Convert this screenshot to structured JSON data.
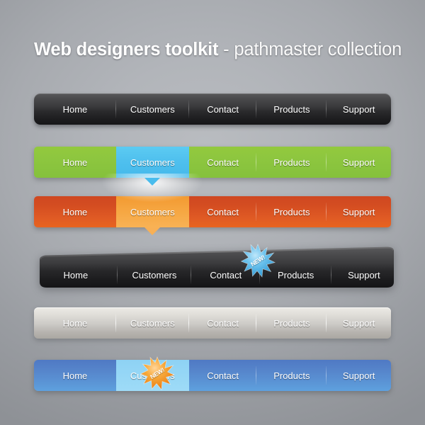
{
  "page": {
    "title_strong": "Web designers toolkit",
    "title_light": " - pathmaster collection",
    "background_color": "#a7aaaf"
  },
  "colors": {
    "dark_bar": "#2a2a2c",
    "green": "#8dc63f",
    "green_active_blue": "#4fc0ee",
    "red_orange": "#d44d21",
    "orange_active": "#f6a641",
    "silver": "#cdcbc7",
    "blue": "#5685cb",
    "blue_active": "#96d7f6",
    "badge_blue": "#4fb4e6",
    "badge_orange": "#f08a1e"
  },
  "labels": {
    "home": "Home",
    "customers": "Customers",
    "contact": "Contact",
    "products": "Products",
    "support": "Support"
  },
  "badges": {
    "new": "NEW!"
  },
  "navbars": [
    {
      "id": "bar1",
      "style": "dark-rounded",
      "active_index": null,
      "items": [
        {
          "label": "Home",
          "active": false
        },
        {
          "label": "Customers",
          "active": false
        },
        {
          "label": "Contact",
          "active": false
        },
        {
          "label": "Products",
          "active": false
        },
        {
          "label": "Support",
          "active": false
        }
      ]
    },
    {
      "id": "bar2",
      "style": "green",
      "active_index": 1,
      "items": [
        {
          "label": "Home",
          "active": false
        },
        {
          "label": "Customers",
          "active": true
        },
        {
          "label": "Contact",
          "active": false
        },
        {
          "label": "Products",
          "active": false
        },
        {
          "label": "Support",
          "active": false
        }
      ]
    },
    {
      "id": "bar3",
      "style": "red-orange",
      "active_index": 1,
      "items": [
        {
          "label": "Home",
          "active": false
        },
        {
          "label": "Customers",
          "active": true
        },
        {
          "label": "Contact",
          "active": false
        },
        {
          "label": "Products",
          "active": false
        },
        {
          "label": "Support",
          "active": false
        }
      ]
    },
    {
      "id": "bar4",
      "style": "dark-slanted",
      "active_index": null,
      "badge_on": "Products",
      "badge_color": "blue",
      "items": [
        {
          "label": "Home",
          "active": false
        },
        {
          "label": "Customers",
          "active": false
        },
        {
          "label": "Contact",
          "active": false
        },
        {
          "label": "Products",
          "active": false
        },
        {
          "label": "Support",
          "active": false
        }
      ]
    },
    {
      "id": "bar5",
      "style": "silver",
      "active_index": null,
      "items": [
        {
          "label": "Home",
          "active": false
        },
        {
          "label": "Customers",
          "active": false
        },
        {
          "label": "Contact",
          "active": false
        },
        {
          "label": "Products",
          "active": false
        },
        {
          "label": "Support",
          "active": false
        }
      ]
    },
    {
      "id": "bar6",
      "style": "blue",
      "active_index": 1,
      "badge_on": "Customers",
      "badge_color": "orange",
      "items": [
        {
          "label": "Home",
          "active": false
        },
        {
          "label": "Customers",
          "active": true
        },
        {
          "label": "Contact",
          "active": false
        },
        {
          "label": "Products",
          "active": false
        },
        {
          "label": "Support",
          "active": false
        }
      ]
    }
  ]
}
